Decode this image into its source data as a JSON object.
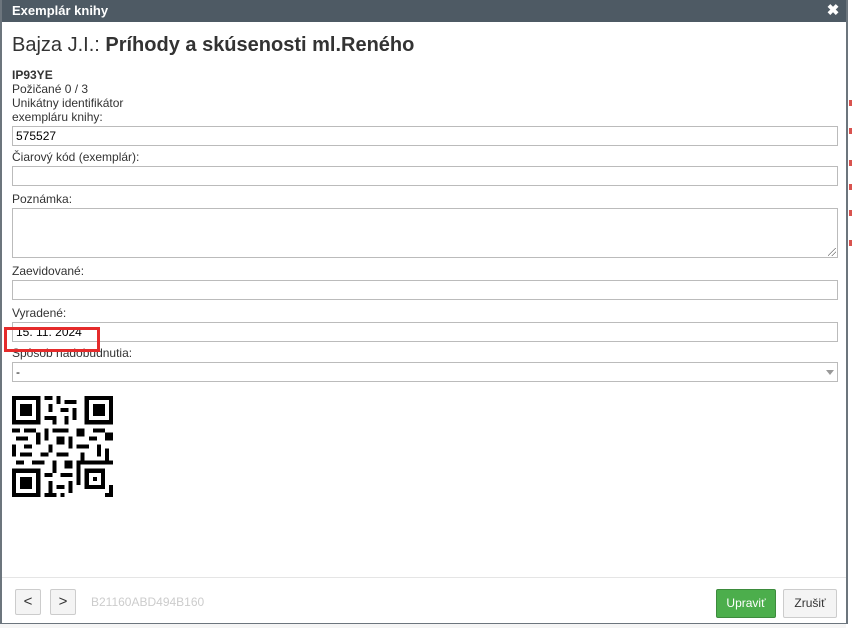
{
  "dialog": {
    "title": "Exemplár knihy",
    "close_symbol": "✖",
    "author": "Bajza J.I.: ",
    "book_title": "Príhody a skúsenosti ml.Reného",
    "code": "IP93YE",
    "loan_status": "Požičané 0 / 3"
  },
  "form": {
    "unique_id_label_line1": "Unikátny identifikátor",
    "unique_id_label_line2": "exempláru knihy:",
    "unique_id_value": "575527",
    "barcode_label": "Čiarový kód (exemplár):",
    "barcode_value": "",
    "note_label": "Poznámka:",
    "note_value": "",
    "registered_label": "Zaevidované:",
    "registered_value": "",
    "discarded_label": "Vyradené:",
    "discarded_value": "15. 11. 2024",
    "acquisition_label": "Spôsob nadobudnutia:",
    "acquisition_value": "-"
  },
  "footer": {
    "prev_label": "<",
    "next_label": ">",
    "identifier": "B21160ABD494B160",
    "save_label": "Upraviť",
    "cancel_label": "Zrušiť"
  },
  "colors": {
    "titlebar": "#4e5a64",
    "primary": "#4cae4c",
    "highlight": "#e52b2b"
  }
}
